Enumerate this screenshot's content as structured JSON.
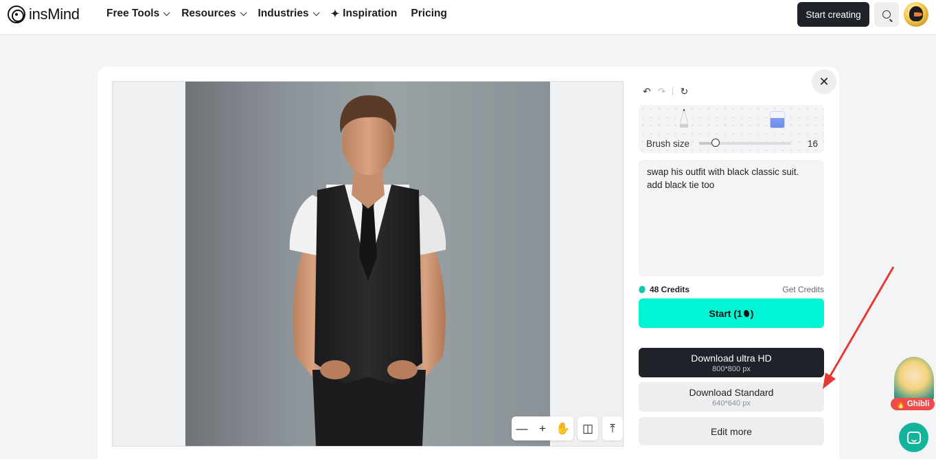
{
  "brand": {
    "name": "insMind"
  },
  "nav": {
    "items": [
      {
        "label": "Free Tools",
        "dropdown": true
      },
      {
        "label": "Resources",
        "dropdown": true
      },
      {
        "label": "Industries",
        "dropdown": true
      },
      {
        "label": "Inspiration",
        "icon": "sparkle-icon"
      },
      {
        "label": "Pricing"
      }
    ],
    "start_label": "Start creating"
  },
  "editor": {
    "brush_size_label": "Brush size",
    "brush_size_value": "16",
    "brush_size_fraction": 0.18,
    "prompt_text": "swap his outfit with black classic suit. add black tie too",
    "credits_label": "48 Credits",
    "get_credits_label": "Get Credits",
    "start_label": "Start (1",
    "start_label_end": ")",
    "download_ultra_label": "Download ultra HD",
    "download_ultra_sub": "800*800 px",
    "download_standard_label": "Download Standard",
    "download_standard_sub": "640*640 px",
    "edit_more_label": "Edit more"
  },
  "widgets": {
    "ghibli_label": "Ghibli"
  },
  "colors": {
    "accent": "#00f5d4",
    "dark": "#1f2329",
    "annotation_arrow": "#e53935"
  }
}
